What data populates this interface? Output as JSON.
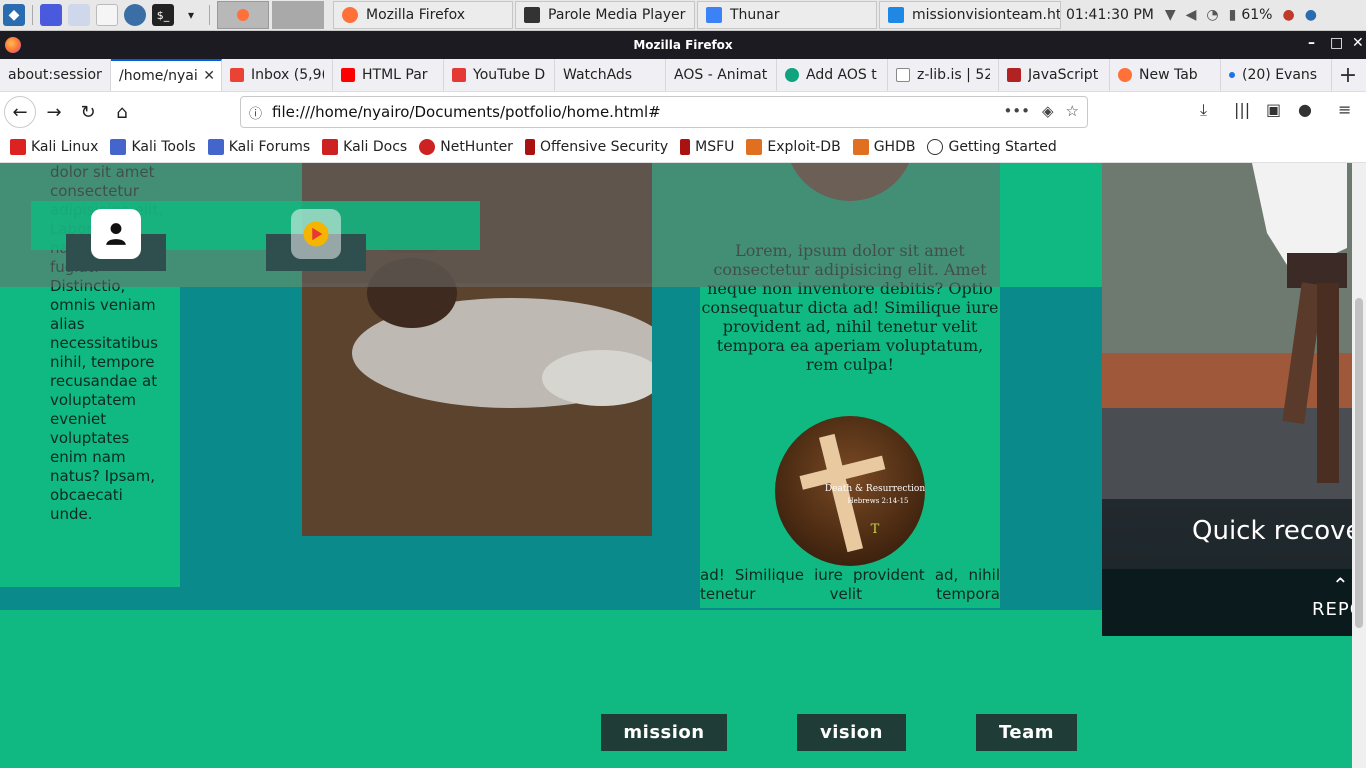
{
  "taskbar": {
    "tasks": [
      {
        "label": "Mozilla Firefox"
      },
      {
        "label": "Parole Media Player"
      },
      {
        "label": "Thunar"
      },
      {
        "label": "missionvisionteam.ht..."
      }
    ],
    "clock": "01:41:30 PM",
    "battery": "61%"
  },
  "window": {
    "title": "Mozilla Firefox"
  },
  "tabs": [
    {
      "label": "about:session",
      "icon": "blank-page"
    },
    {
      "label": "/home/nyai",
      "icon": "none",
      "active": true
    },
    {
      "label": "Inbox (5,9(",
      "icon": "gmail"
    },
    {
      "label": "HTML Par",
      "icon": "youtube"
    },
    {
      "label": "YouTube D",
      "icon": "download"
    },
    {
      "label": "WatchAds",
      "icon": "none"
    },
    {
      "label": "AOS - Animat",
      "icon": "none"
    },
    {
      "label": "Add AOS t",
      "icon": "openai"
    },
    {
      "label": "z-lib.is | 52",
      "icon": "zlib"
    },
    {
      "label": "JavaScript",
      "icon": "pd"
    },
    {
      "label": "New Tab",
      "icon": "firefox"
    },
    {
      "label": "(20) Evans",
      "icon": "dot"
    }
  ],
  "navbar": {
    "url": "file:///home/nyairo/Documents/potfolio/home.html#"
  },
  "bookmarks": [
    {
      "label": "Kali Linux",
      "color": "#d22"
    },
    {
      "label": "Kali Tools",
      "color": "#4466cc"
    },
    {
      "label": "Kali Forums",
      "color": "#4466cc"
    },
    {
      "label": "Kali Docs",
      "color": "#cc2222"
    },
    {
      "label": "NetHunter",
      "color": "#cc2222"
    },
    {
      "label": "Offensive Security",
      "color": "#aa1111"
    },
    {
      "label": "MSFU",
      "color": "#aa1111"
    },
    {
      "label": "Exploit-DB",
      "color": "#e07020"
    },
    {
      "label": "GHDB",
      "color": "#e07020"
    },
    {
      "label": "Getting Started",
      "color": "#333333"
    }
  ],
  "page": {
    "col1_text": "dolor sit amet consectetur adipisicing elit. Laboriosam nam odit fugiat! Distinctio, omnis veniam alias necessitatibus nihil, tempore recusandae at voluptatem eveniet voluptates enim nam natus? Ipsam, obcaecati unde.",
    "col3_lorem": "Lorem, ipsum dolor sit amet consectetur adipisicing elit. Amet neque non inventore debitis? Optio consequatur dicta ad! Similique iure provident ad, nihil tenetur velit tempora ea aperiam voluptatum, rem culpa!",
    "col3_bottom_line1": "ad! Similique iure provident ad, nihil",
    "col3_bottom_line2": "tenetur velit tempora",
    "cross_title": "Death & Resurrection",
    "cross_verse": "Hebrews 2:14-15",
    "photo2_caption": "Quick recover",
    "photo2_link": "REPO",
    "buttons": {
      "mission": "mission",
      "vision": "vision",
      "team": "Team"
    }
  },
  "colors": {
    "page_green": "#10b981",
    "teal_band": "#0a8a8a",
    "button_dark": "#1f3d36"
  }
}
